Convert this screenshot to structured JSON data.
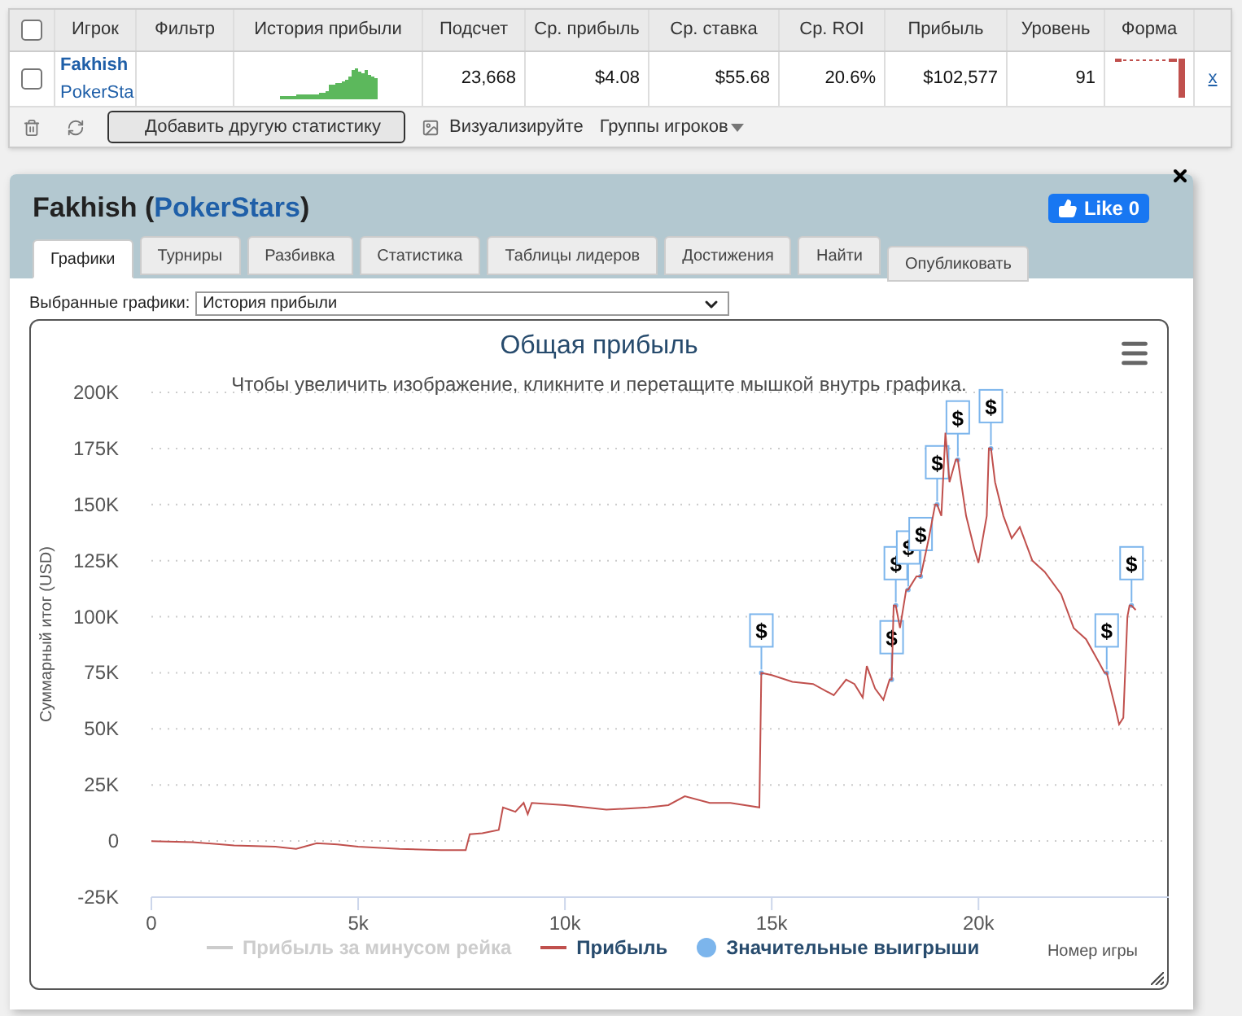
{
  "table": {
    "columns": [
      {
        "label": "Игрок"
      },
      {
        "label": "Фильтр"
      },
      {
        "label": "История прибыли"
      },
      {
        "label": "Подсчет"
      },
      {
        "label": "Ср. прибыль"
      },
      {
        "label": "Ср. ставка"
      },
      {
        "label": "Ср. ROI"
      },
      {
        "label": "Прибыль"
      },
      {
        "label": "Уровень"
      },
      {
        "label": "Форма"
      }
    ],
    "header_checked": false,
    "rows": [
      {
        "checked": false,
        "player": "Fakhish",
        "site": "PokerSta",
        "count": "23,668",
        "avg_profit": "$4.08",
        "avg_stake": "$55.68",
        "avg_roi": "20.6%",
        "profit": "$102,577",
        "level": "91",
        "remove": "x"
      }
    ]
  },
  "toolbar": {
    "add_button": "Добавить другую статистику",
    "visualize": "Визуализируйте",
    "groups": "Группы игроков"
  },
  "panel": {
    "player": "Fakhish",
    "open_paren": "(",
    "site": "PokerStars",
    "close_paren": ")",
    "like": "Like 0",
    "flag_label": "$",
    "tabs": [
      {
        "label": "Графики",
        "selected": true
      },
      {
        "label": "Турниры",
        "selected": false
      },
      {
        "label": "Разбивка",
        "selected": false
      },
      {
        "label": "Статистика",
        "selected": false
      },
      {
        "label": "Таблицы лидеров",
        "selected": false
      },
      {
        "label": "Достижения",
        "selected": false
      },
      {
        "label": "Найти",
        "selected": false
      }
    ],
    "publish": "Опубликовать",
    "select_label": "Выбранные графики:",
    "select_value": "История прибыли",
    "legend": [
      {
        "label": "Прибыль за минусом рейка",
        "kind": "line",
        "visible": false
      },
      {
        "kind": "line",
        "visible": true
      },
      {
        "kind": "dot",
        "visible": true
      }
    ],
    "chart_data": {
      "type": "line",
      "grid": true,
      "legend": true,
      "title": "Общая прибыль",
      "subtitle": "Чтобы увеличить изображение, кликните и перетащите мышкой внутрь графика.",
      "xlabel": "Номер игры",
      "ylabel": "Суммарный итог (USD)",
      "xlim": [
        0,
        24600
      ],
      "ylim": [
        -25000,
        200000
      ],
      "xticks": [
        {
          "value": 0,
          "label": "0"
        },
        {
          "value": 5000,
          "label": "5k"
        },
        {
          "value": 10000,
          "label": "10k"
        },
        {
          "value": 15000,
          "label": "15k"
        },
        {
          "value": 20000,
          "label": "20k"
        }
      ],
      "yticks": [
        {
          "value": -25000,
          "label": "-25K"
        },
        {
          "value": 0,
          "label": "0"
        },
        {
          "value": 25000,
          "label": "25K"
        },
        {
          "value": 50000,
          "label": "50K"
        },
        {
          "value": 75000,
          "label": "75K"
        },
        {
          "value": 100000,
          "label": "100K"
        },
        {
          "value": 125000,
          "label": "125K"
        },
        {
          "value": 150000,
          "label": "150K"
        },
        {
          "value": 175000,
          "label": "175K"
        },
        {
          "value": 200000,
          "label": "200K"
        }
      ],
      "x": [
        0,
        1000,
        2000,
        3000,
        3500,
        4000,
        4500,
        5000,
        6000,
        7000,
        7600,
        7700,
        8000,
        8400,
        8500,
        8800,
        9000,
        9100,
        9200,
        10000,
        11000,
        12000,
        12500,
        12900,
        13500,
        14000,
        14700,
        14750,
        15000,
        15500,
        16000,
        16500,
        16800,
        17000,
        17200,
        17300,
        17500,
        17700,
        17850,
        17900,
        17950,
        18000,
        18100,
        18250,
        18300,
        18500,
        18600,
        18800,
        18950,
        19000,
        19100,
        19200,
        19300,
        19450,
        19500,
        19700,
        19900,
        20000,
        20200,
        20250,
        20300,
        20400,
        20600,
        20800,
        21000,
        21300,
        21600,
        22000,
        22300,
        22600,
        22900,
        23050,
        23100,
        23300,
        23400,
        23500,
        23600,
        23650,
        23700,
        23800
      ],
      "series": [
        {
          "name": "Прибыль",
          "color": "#c0504d",
          "values": [
            0,
            -500,
            -2000,
            -2500,
            -3500,
            -1000,
            -1500,
            -2500,
            -3500,
            -4000,
            -4000,
            3000,
            3500,
            5000,
            15000,
            13000,
            17000,
            12000,
            17000,
            16000,
            14000,
            15000,
            16000,
            20000,
            17000,
            17000,
            15000,
            75000,
            74000,
            71000,
            70000,
            65000,
            72000,
            70000,
            64000,
            78000,
            68000,
            63000,
            72000,
            72000,
            105000,
            105000,
            95000,
            112000,
            112000,
            118000,
            118000,
            135000,
            150000,
            150000,
            145000,
            182000,
            160000,
            170000,
            170000,
            145000,
            130000,
            124000,
            145000,
            175000,
            175000,
            160000,
            145000,
            135000,
            140000,
            125000,
            120000,
            110000,
            95000,
            90000,
            80000,
            75000,
            75000,
            60000,
            52000,
            55000,
            100000,
            105000,
            105000,
            103000
          ]
        },
        {
          "name": "Значительные выигрыши",
          "color": "#7cb5ec",
          "marker": true,
          "values": [
            null,
            null,
            null,
            null,
            null,
            null,
            null,
            null,
            null,
            null,
            null,
            null,
            null,
            null,
            null,
            null,
            null,
            null,
            null,
            null,
            null,
            null,
            null,
            null,
            null,
            null,
            null,
            75000,
            null,
            null,
            null,
            null,
            null,
            null,
            null,
            null,
            null,
            null,
            null,
            72000,
            null,
            105000,
            null,
            null,
            112000,
            null,
            118000,
            null,
            null,
            150000,
            null,
            null,
            null,
            null,
            170000,
            null,
            null,
            null,
            null,
            null,
            175000,
            null,
            null,
            null,
            null,
            null,
            null,
            null,
            null,
            null,
            null,
            null,
            75000,
            null,
            null,
            null,
            null,
            null,
            105000,
            null
          ]
        }
      ]
    }
  }
}
